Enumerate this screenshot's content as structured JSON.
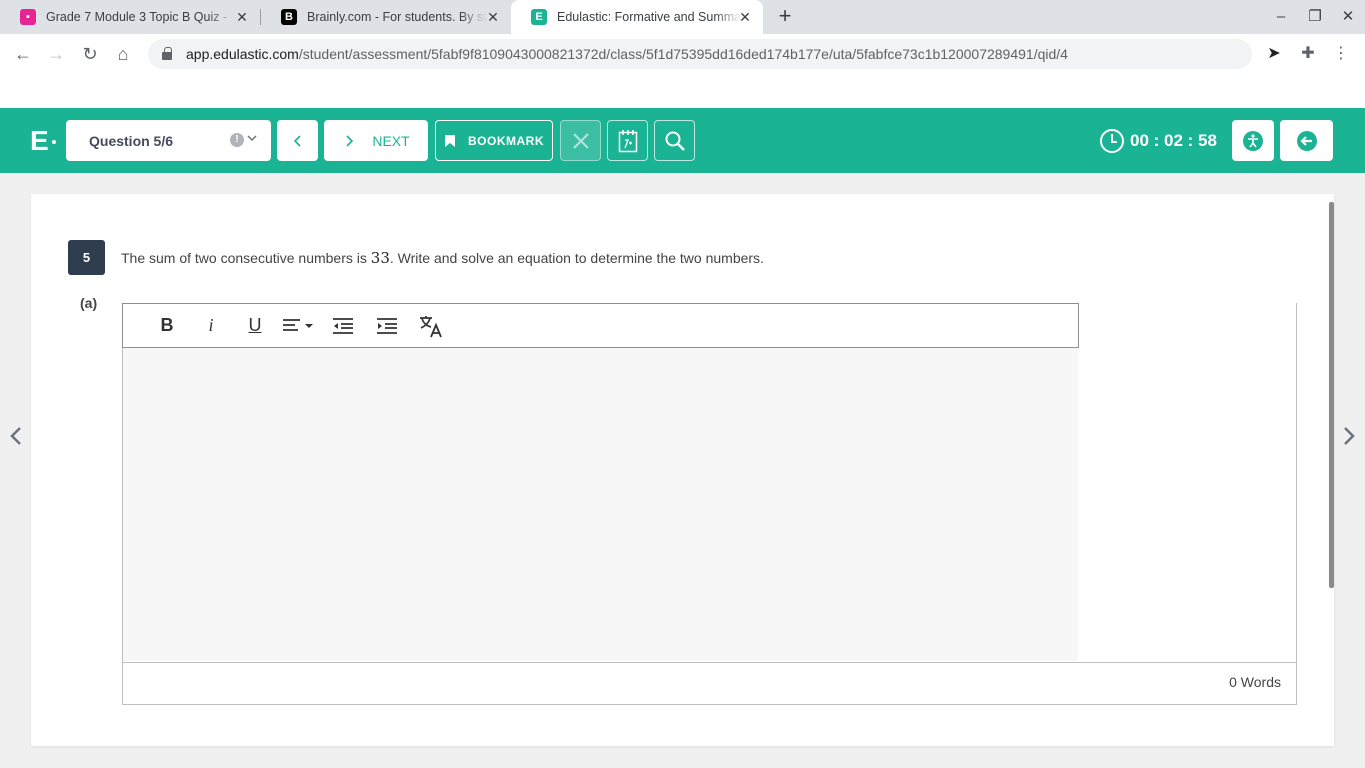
{
  "browser": {
    "tabs": [
      {
        "title": "Grade 7 Module 3 Topic B Quiz - ",
        "favicon": "quiz-favicon",
        "favicon_color": "#e52592"
      },
      {
        "title": "Brainly.com - For students. By students.",
        "favicon": "brainly-favicon",
        "favicon_color": "#000000"
      },
      {
        "title": "Edulastic: Formative and Summative Assessments",
        "favicon": "edulastic-favicon",
        "favicon_color": "#1ab394"
      }
    ],
    "url_host": "app.edulastic.com",
    "url_path": "/student/assessment/5fabf9f8109043000821372d/class/5f1d75395dd16ded174b177e/uta/5fabfce73c1b120007289491/qid/4"
  },
  "header": {
    "question_selector": "Question 5/6",
    "next_label": "NEXT",
    "bookmark_label": "BOOKMARK",
    "timer": "00 : 02 : 58",
    "accent_color": "#1ab394"
  },
  "question": {
    "number": "5",
    "text_before": "The sum of two consecutive numbers is ",
    "math_value": "33",
    "text_after": ".  Write and solve an equation to determine the two numbers.",
    "part_label": "(a)",
    "word_count": "0 Words"
  }
}
